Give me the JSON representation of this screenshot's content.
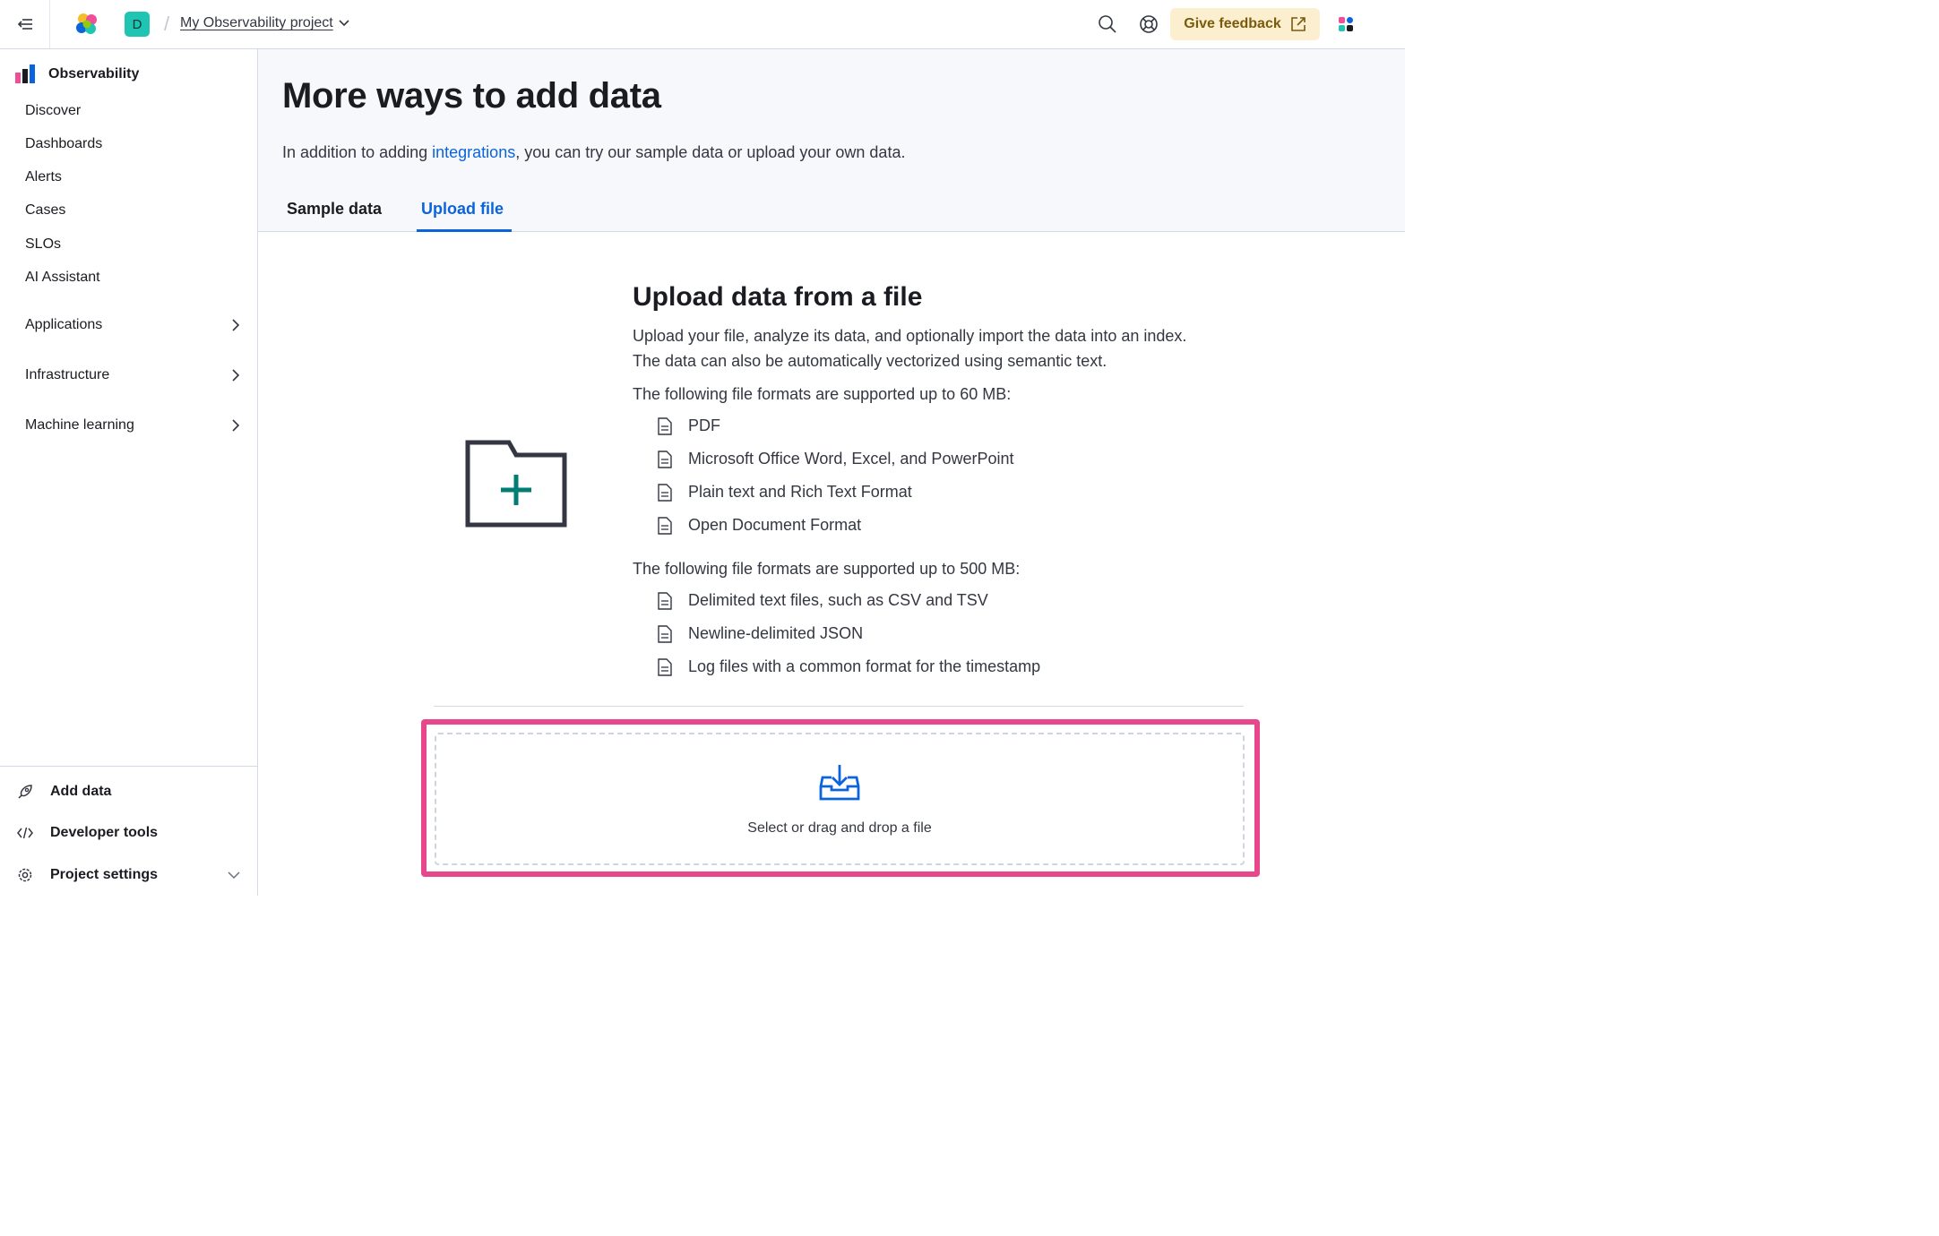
{
  "header": {
    "avatar_letter": "D",
    "project_name": "My Observability project",
    "feedback_label": "Give feedback"
  },
  "sidebar": {
    "title": "Observability",
    "items": [
      "Discover",
      "Dashboards",
      "Alerts",
      "Cases",
      "SLOs",
      "AI Assistant"
    ],
    "groups": [
      "Applications",
      "Infrastructure",
      "Machine learning"
    ],
    "footer": [
      "Add data",
      "Developer tools",
      "Project settings"
    ]
  },
  "page": {
    "title": "More ways to add data",
    "desc_before": "In addition to adding ",
    "desc_link": "integrations",
    "desc_after": ", you can try our sample data or upload your own data.",
    "tabs": [
      "Sample data",
      "Upload file"
    ]
  },
  "upload": {
    "title": "Upload data from a file",
    "intro_line1": "Upload your file, analyze its data, and optionally import the data into an index.",
    "intro_line2": "The data can also be automatically vectorized using semantic text.",
    "small_heading": "The following file formats are supported up to 60 MB:",
    "small_formats": [
      "PDF",
      "Microsoft Office Word, Excel, and PowerPoint",
      "Plain text and Rich Text Format",
      "Open Document Format"
    ],
    "large_heading": "The following file formats are supported up to 500 MB:",
    "large_formats": [
      "Delimited text files, such as CSV and TSV",
      "Newline-delimited JSON",
      "Log files with a common format for the timestamp"
    ],
    "dropzone_label": "Select or drag and drop a file"
  },
  "colors": {
    "accent": "#0b64dd",
    "highlight": "#e8488b",
    "feedback_bg": "#fcefd0",
    "avatar_bg": "#20c4b3"
  }
}
